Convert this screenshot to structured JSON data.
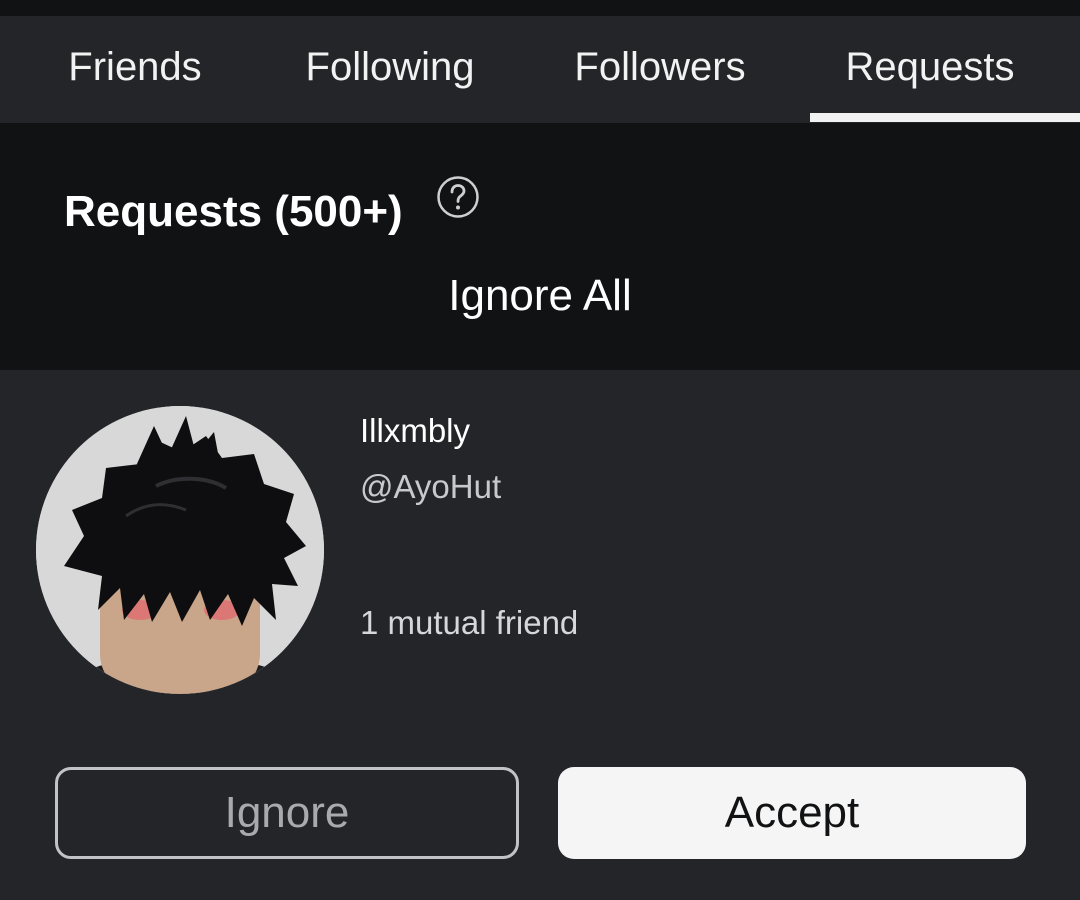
{
  "tabs": [
    {
      "label": "Friends",
      "active": false
    },
    {
      "label": "Following",
      "active": false
    },
    {
      "label": "Followers",
      "active": false
    },
    {
      "label": "Requests",
      "active": true
    }
  ],
  "requests_header": {
    "title": "Requests (500+)",
    "help_icon": "question-circle-icon",
    "ignore_all_label": "Ignore All"
  },
  "request": {
    "display_name": "Illxmbly",
    "username": "@AyoHut",
    "mutual_friends": "1 mutual friend",
    "avatar_icon": "user-avatar",
    "ignore_label": "Ignore",
    "accept_label": "Accept"
  },
  "colors": {
    "background": "#232529",
    "header_background": "#111214",
    "text": "#ffffff",
    "accept_button": "#f5f5f5"
  }
}
